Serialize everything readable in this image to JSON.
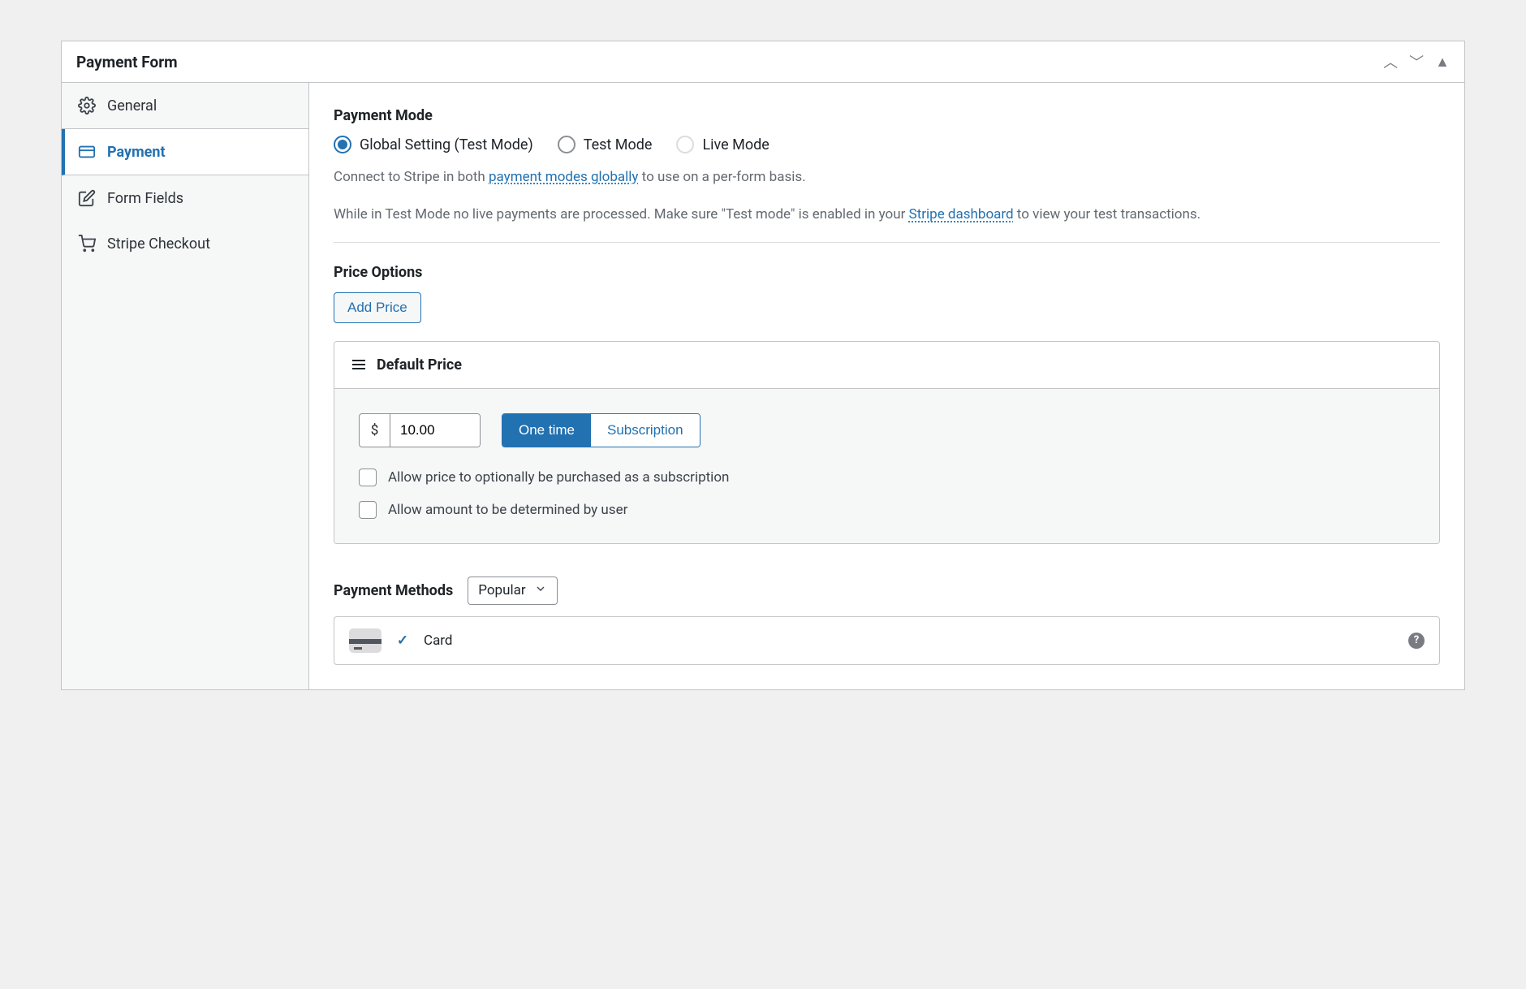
{
  "metabox": {
    "title": "Payment Form"
  },
  "sidebar": {
    "items": [
      {
        "label": "General"
      },
      {
        "label": "Payment"
      },
      {
        "label": "Form Fields"
      },
      {
        "label": "Stripe Checkout"
      }
    ]
  },
  "payment_mode": {
    "heading": "Payment Mode",
    "options": [
      {
        "label": "Global Setting (Test Mode)",
        "selected": true
      },
      {
        "label": "Test Mode",
        "selected": false
      },
      {
        "label": "Live Mode",
        "selected": false,
        "disabled": true
      }
    ],
    "help1_prefix": "Connect to Stripe in both ",
    "help1_link": "payment modes globally",
    "help1_suffix": " to use on a per-form basis.",
    "help2_prefix": "While in Test Mode no live payments are processed. Make sure \"Test mode\" is enabled in your ",
    "help2_link": "Stripe dashboard",
    "help2_suffix": " to view your test transactions."
  },
  "price_options": {
    "heading": "Price Options",
    "add_button": "Add Price",
    "panel_title": "Default Price",
    "currency_symbol": "$",
    "amount": "10.00",
    "toggle_one_time": "One time",
    "toggle_subscription": "Subscription",
    "check_opt_sub": "Allow price to optionally be purchased as a subscription",
    "check_user_amount": "Allow amount to be determined by user"
  },
  "payment_methods": {
    "heading": "Payment Methods",
    "filter_selected": "Popular",
    "items": [
      {
        "label": "Card",
        "checked": true
      }
    ]
  }
}
